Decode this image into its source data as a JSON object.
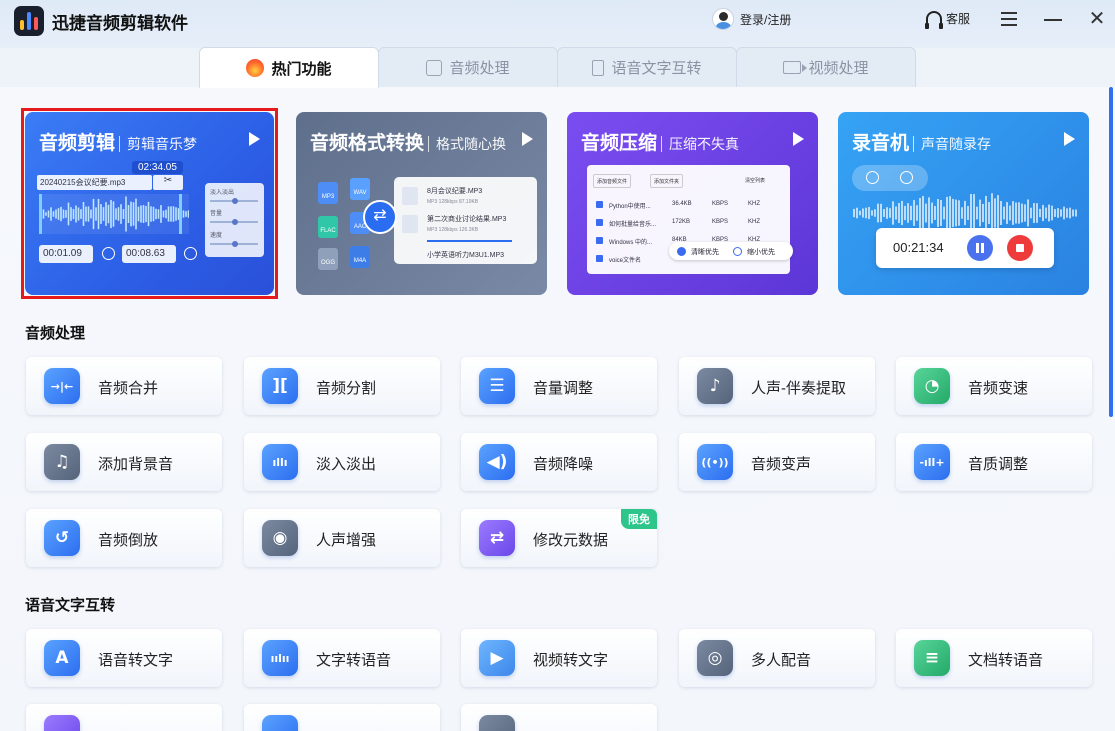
{
  "app": {
    "title": "迅捷音频剪辑软件"
  },
  "header": {
    "login_label": "登录/注册",
    "service_label": "客服"
  },
  "tabs": [
    {
      "label": "热门功能",
      "active": true,
      "icon": "flame-icon"
    },
    {
      "label": "音频处理",
      "active": false,
      "icon": "audio-file-icon"
    },
    {
      "label": "语音文字互转",
      "active": false,
      "icon": "mic-file-icon"
    },
    {
      "label": "视频处理",
      "active": false,
      "icon": "video-camera-icon"
    }
  ],
  "hero_cards": [
    {
      "title": "音频剪辑",
      "subtitle": "剪辑音乐梦",
      "time_badge": "02:34.05",
      "file_name": "20240215会议纪要.mp3",
      "panel_labels": [
        "淡入淡出",
        "音量",
        "速度"
      ],
      "start_time": "00:01.09",
      "end_time": "00:08.63"
    },
    {
      "title": "音频格式转换",
      "subtitle": "格式随心换",
      "formats": [
        "MP3",
        "WAV",
        "FLAC",
        "AAC",
        "OGG",
        "M4A"
      ],
      "files": [
        {
          "name": "8月会议纪要.MP3",
          "meta": "MP3   128kbps   87.19KB"
        },
        {
          "name": "第二次商业讨论结果.MP3",
          "meta": "MP3   128kbps   126.3KB"
        },
        {
          "name": "小学英语听力M3U1.MP3",
          "meta": ""
        }
      ]
    },
    {
      "title": "音频压缩",
      "subtitle": "压缩不失真",
      "buttons": [
        "添加音频文件",
        "添加文件夹",
        "清空列表"
      ],
      "rows": [
        {
          "name": "Python中使用...",
          "size": "36.4KB",
          "unit1": "KBPS",
          "unit2": "KHZ"
        },
        {
          "name": "如何批量给音乐...",
          "size": "172KB",
          "unit1": "KBPS",
          "unit2": "KHZ"
        },
        {
          "name": "Windows 中的...",
          "size": "84KB",
          "unit1": "KBPS",
          "unit2": "KHZ"
        },
        {
          "name": "voice文件名",
          "size": "",
          "unit1": "",
          "unit2": ""
        }
      ],
      "option_clear": "清晰优先",
      "option_small": "缩小优先"
    },
    {
      "title": "录音机",
      "subtitle": "声音随录存",
      "timer": "00:21:34"
    }
  ],
  "sections": [
    {
      "title": "音频处理",
      "tools": [
        {
          "label": "音频合并",
          "icon": "merge-icon",
          "glyph": "→|←",
          "color": "blue"
        },
        {
          "label": "音频分割",
          "icon": "split-icon",
          "glyph": "][",
          "color": "blue"
        },
        {
          "label": "音量调整",
          "icon": "volume-sliders-icon",
          "glyph": "☰",
          "color": "blue"
        },
        {
          "label": "人声-伴奏提取",
          "icon": "vocal-extract-icon",
          "glyph": "♪",
          "color": "gray"
        },
        {
          "label": "音频变速",
          "icon": "speed-icon",
          "glyph": "◔",
          "color": "green"
        },
        {
          "label": "添加背景音",
          "icon": "music-note-icon",
          "glyph": "♫",
          "color": "gray"
        },
        {
          "label": "淡入淡出",
          "icon": "fade-bars-icon",
          "glyph": "ıllı",
          "color": "blue"
        },
        {
          "label": "音频降噪",
          "icon": "speaker-icon",
          "glyph": "◀)",
          "color": "blue"
        },
        {
          "label": "音频变声",
          "icon": "voice-change-icon",
          "glyph": "((•))",
          "color": "blue"
        },
        {
          "label": "音质调整",
          "icon": "quality-bars-icon",
          "glyph": "-ıll+",
          "color": "blue"
        },
        {
          "label": "音频倒放",
          "icon": "reverse-icon",
          "glyph": "↺",
          "color": "blue"
        },
        {
          "label": "人声增强",
          "icon": "voice-enhance-icon",
          "glyph": "◉",
          "color": "gray"
        },
        {
          "label": "修改元数据",
          "icon": "metadata-icon",
          "glyph": "⇄",
          "color": "purple",
          "badge": "限免"
        }
      ]
    },
    {
      "title": "语音文字互转",
      "tools": [
        {
          "label": "语音转文字",
          "icon": "letter-a-icon",
          "glyph": "A",
          "color": "blue"
        },
        {
          "label": "文字转语音",
          "icon": "waveform-icon",
          "glyph": "ıılıı",
          "color": "blue"
        },
        {
          "label": "视频转文字",
          "icon": "play-icon",
          "glyph": "▶",
          "color": "teal"
        },
        {
          "label": "多人配音",
          "icon": "microphone-icon",
          "glyph": "◎",
          "color": "gray"
        },
        {
          "label": "文档转语音",
          "icon": "document-icon",
          "glyph": "≡",
          "color": "green"
        }
      ]
    }
  ],
  "colors": {
    "accent": "#2c6ef0",
    "selection_outline": "#e51b1b",
    "free_badge": "#2ec58a"
  }
}
